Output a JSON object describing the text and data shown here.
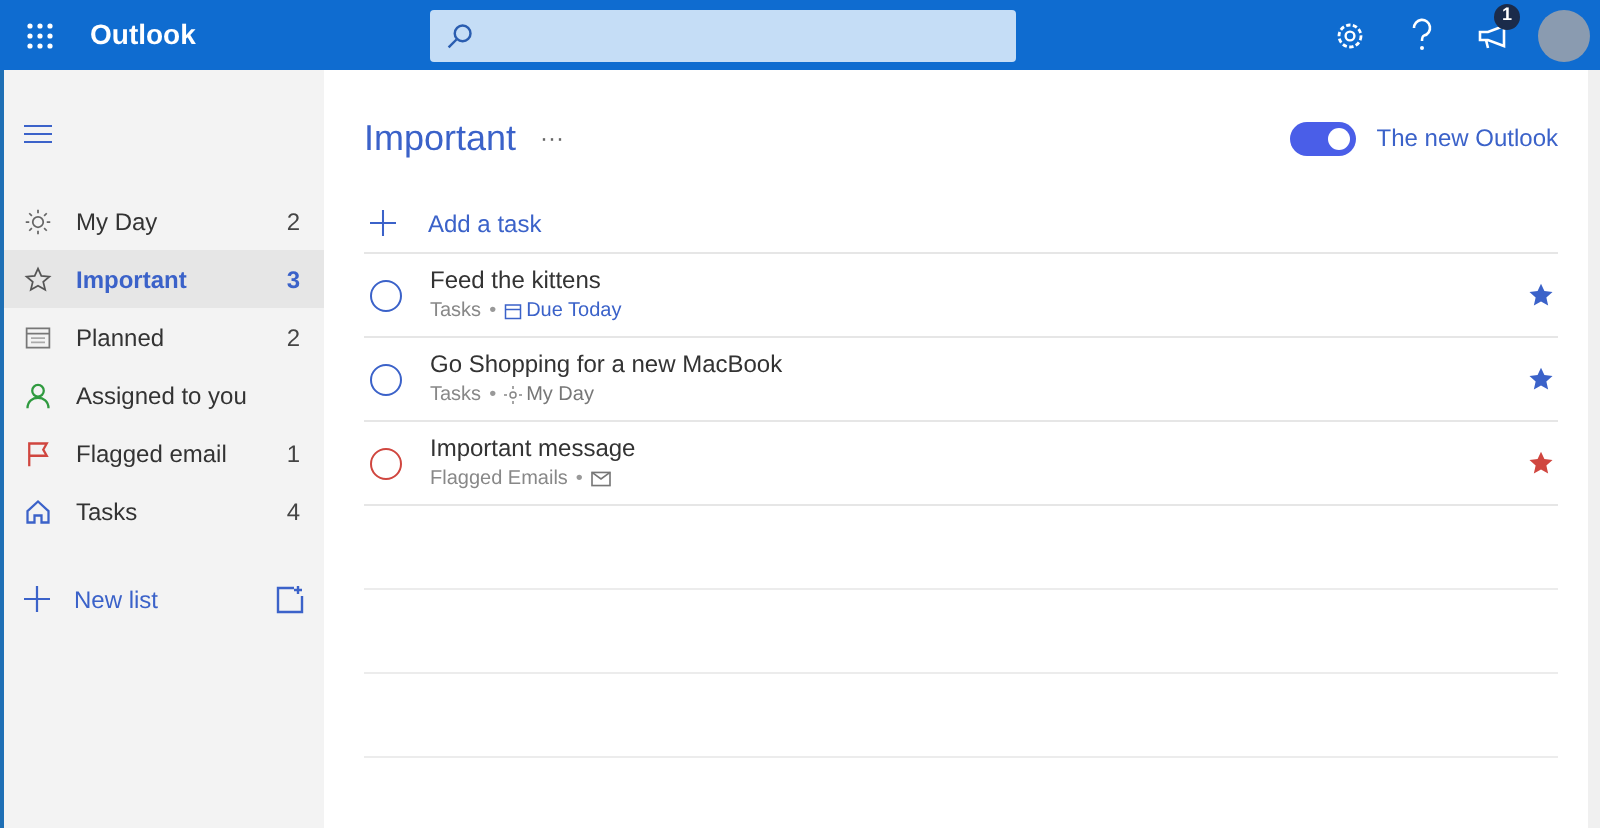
{
  "header": {
    "app_name": "Outlook",
    "notification_count": "1"
  },
  "sidebar": {
    "items": [
      {
        "kind": "sun",
        "label": "My Day",
        "count": "2",
        "selected": false
      },
      {
        "kind": "star",
        "label": "Important",
        "count": "3",
        "selected": true
      },
      {
        "kind": "calendar",
        "label": "Planned",
        "count": "2",
        "selected": false
      },
      {
        "kind": "person",
        "label": "Assigned to you",
        "selected": false
      },
      {
        "kind": "flag",
        "label": "Flagged email",
        "count": "1",
        "selected": false
      },
      {
        "kind": "home",
        "label": "Tasks",
        "count": "4",
        "selected": false
      }
    ],
    "new_list": "New list"
  },
  "main": {
    "title": "Important",
    "more": "···",
    "toggle": {
      "label": "The new Outlook",
      "on": true
    },
    "add_task": "Add a task",
    "tasks": [
      {
        "title": "Feed the kittens",
        "list": "Tasks",
        "separator": "•",
        "kind": "due",
        "detail": "Due Today",
        "color": "#3b62c9"
      },
      {
        "title": "Go Shopping for a new MacBook",
        "list": "Tasks",
        "separator": "•",
        "kind": "myday",
        "detail": "My Day",
        "color": "#3b62c9"
      },
      {
        "title": "Important message",
        "list": "Flagged Emails",
        "separator": "•",
        "kind": "mail",
        "color": "#d0463f"
      }
    ]
  }
}
